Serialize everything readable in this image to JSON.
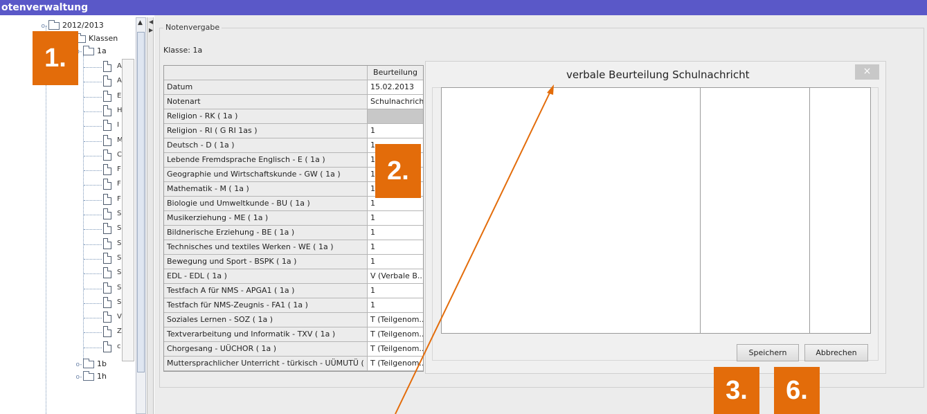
{
  "window": {
    "title": "otenverwaltung"
  },
  "tree": {
    "year": "2012/2013",
    "classes_folder": "Klassen",
    "class_selected": "1a",
    "doc_letters": [
      "A",
      "A",
      "E",
      "H",
      "I",
      "M",
      "C",
      "F",
      "F",
      "F",
      "S",
      "S",
      "S",
      "S",
      "S",
      "S",
      "S",
      "V",
      "Z",
      "c"
    ],
    "other_classes": [
      "1b",
      "1h"
    ]
  },
  "panel": {
    "group_title": "Notenvergabe",
    "class_label": "Klasse: 1a"
  },
  "table": {
    "header_value": "Beurteilung",
    "rows": [
      {
        "subject": "Datum",
        "value": "15.02.2013"
      },
      {
        "subject": "Notenart",
        "value": "Schulnachricht"
      },
      {
        "subject": "Religion - RK  ( 1a )",
        "value": ""
      },
      {
        "subject": "Religion - RI  ( G RI 1as )",
        "value": "1"
      },
      {
        "subject": "Deutsch - D  ( 1a )",
        "value": "1"
      },
      {
        "subject": "Lebende Fremdsprache Englisch - E  ( 1a )",
        "value": "1"
      },
      {
        "subject": "Geographie und Wirtschaftskunde - GW  ( 1a )",
        "value": "1"
      },
      {
        "subject": "Mathematik - M  ( 1a )",
        "value": "1"
      },
      {
        "subject": "Biologie und Umweltkunde - BU  ( 1a )",
        "value": "1"
      },
      {
        "subject": "Musikerziehung - ME  ( 1a )",
        "value": "1"
      },
      {
        "subject": "Bildnerische Erziehung - BE  ( 1a )",
        "value": "1"
      },
      {
        "subject": "Technisches und textiles Werken - WE  ( 1a )",
        "value": "1"
      },
      {
        "subject": "Bewegung und Sport - BSPK  ( 1a )",
        "value": "1"
      },
      {
        "subject": "EDL - EDL  ( 1a )",
        "value": "V (Verbale B..."
      },
      {
        "subject": "Testfach A für NMS - APGA1  ( 1a )",
        "value": "1"
      },
      {
        "subject": "Testfach für NMS-Zeugnis - FA1  ( 1a )",
        "value": "1"
      },
      {
        "subject": "Soziales Lernen - SOZ  ( 1a )",
        "value": "T (Teilgenom..."
      },
      {
        "subject": "Textverarbeitung und Informatik - TXV  ( 1a )",
        "value": "T (Teilgenom..."
      },
      {
        "subject": "Chorgesang - UÜCHOR  ( 1a )",
        "value": "T (Teilgenom..."
      },
      {
        "subject": "Muttersprachlicher Unterricht - türkisch - UÜMUTÜ  ( ...",
        "value": "T (Teilgenom..."
      }
    ]
  },
  "dialog": {
    "title": "verbale Beurteilung   Schulnachricht",
    "close_glyph": "×",
    "save_label": "Speichern",
    "cancel_label": "Abbrechen"
  },
  "annotations": {
    "badge1": "1.",
    "badge2": "2.",
    "badge3": "3.",
    "badge6": "6.",
    "color": "#e36c0a"
  },
  "colors": {
    "titlebar": "#5a58c8",
    "panel_bg": "#ececec"
  }
}
